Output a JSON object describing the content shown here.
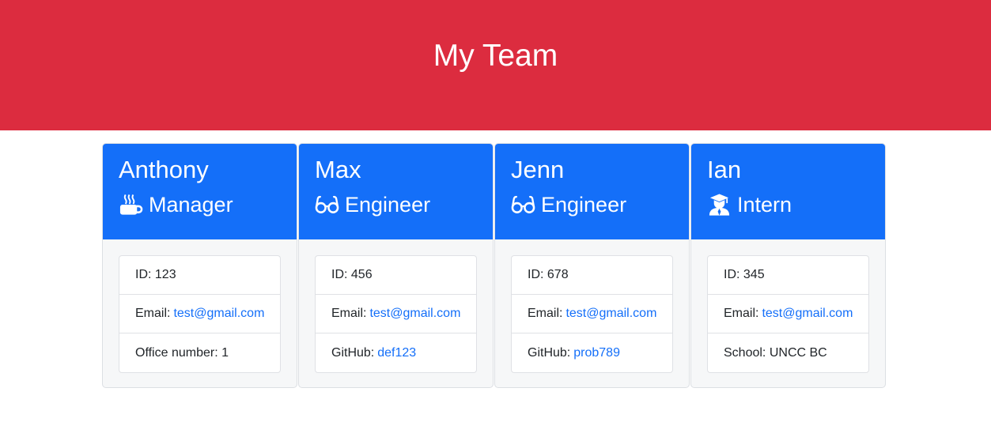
{
  "header": {
    "title": "My Team"
  },
  "colors": {
    "banner": "#dc2c3f",
    "card_header": "#146ff9",
    "link": "#146ff9"
  },
  "cards": [
    {
      "name": "Anthony",
      "role": "Manager",
      "icon": "coffee-mug-icon",
      "id_label": "ID:",
      "id": "123",
      "email_label": "Email:",
      "email": "test@gmail.com",
      "extra_label": "Office number:",
      "extra": "1"
    },
    {
      "name": "Max",
      "role": "Engineer",
      "icon": "glasses-icon",
      "id_label": "ID:",
      "id": "456",
      "email_label": "Email:",
      "email": "test@gmail.com",
      "extra_label": "GitHub:",
      "extra": "def123"
    },
    {
      "name": "Jenn",
      "role": "Engineer",
      "icon": "glasses-icon",
      "id_label": "ID:",
      "id": "678",
      "email_label": "Email:",
      "email": "test@gmail.com",
      "extra_label": "GitHub:",
      "extra": "prob789"
    },
    {
      "name": "Ian",
      "role": "Intern",
      "icon": "graduate-icon",
      "id_label": "ID:",
      "id": "345",
      "email_label": "Email:",
      "email": "test@gmail.com",
      "extra_label": "School:",
      "extra": "UNCC BC"
    }
  ]
}
